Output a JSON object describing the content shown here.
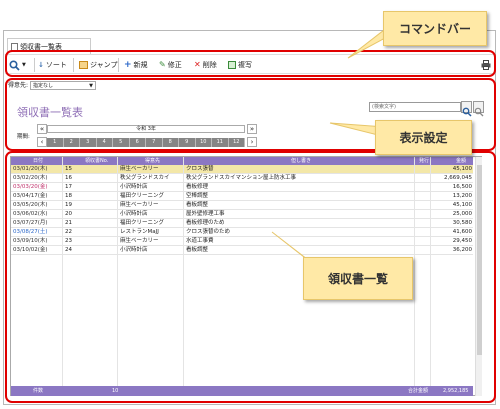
{
  "tab": {
    "title": "領収書一覧表"
  },
  "toolbar": {
    "sort": "ソート",
    "jump": "ジャンプ",
    "new": "新規",
    "edit": "修正",
    "delete": "削除",
    "copy": "複写"
  },
  "filter": {
    "label": "得意先:",
    "value": "指定なし"
  },
  "page": {
    "title": "領収書一覧表"
  },
  "search": {
    "placeholder": "(検索文字)"
  },
  "period": {
    "label": "期間:",
    "year": "令和 3年",
    "months": [
      "1",
      "2",
      "3",
      "4",
      "5",
      "6",
      "7",
      "8",
      "9",
      "10",
      "11",
      "12"
    ]
  },
  "table": {
    "headers": [
      "日付",
      "領収書No.",
      "得意先",
      "但し書き",
      "発行",
      "金額"
    ],
    "rows": [
      {
        "date": "03/01/20(木)",
        "no": "15",
        "customer": "麻生ベーカリー",
        "note": "クロス張替",
        "issued": "",
        "amount": "45,100"
      },
      {
        "date": "03/02/20(木)",
        "no": "16",
        "customer": "秩父グランドスカイ",
        "note": "秩父グランドスカイマンション屋上防水工事",
        "issued": "",
        "amount": "2,669,045"
      },
      {
        "date": "03/03/20(金)",
        "no": "17",
        "customer": "小沢時計店",
        "note": "看板修理",
        "issued": "",
        "amount": "16,500"
      },
      {
        "date": "03/04/17(金)",
        "no": "18",
        "customer": "福田クリーニング",
        "note": "空棒調整",
        "issued": "",
        "amount": "13,200"
      },
      {
        "date": "03/05/20(木)",
        "no": "19",
        "customer": "麻生ベーカリー",
        "note": "看板調整",
        "issued": "",
        "amount": "45,100"
      },
      {
        "date": "03/06/02(水)",
        "no": "20",
        "customer": "小沢時計店",
        "note": "屋外壁修理工事",
        "issued": "",
        "amount": "25,000"
      },
      {
        "date": "03/07/27(月)",
        "no": "21",
        "customer": "福田クリーニング",
        "note": "看板修理のため",
        "issued": "",
        "amount": "30,580"
      },
      {
        "date": "03/08/27(土)",
        "no": "22",
        "customer": "レストランMaJJ",
        "note": "クロス張替のため",
        "issued": "",
        "amount": "41,600"
      },
      {
        "date": "03/09/10(木)",
        "no": "23",
        "customer": "麻生ベーカリー",
        "note": "水道工事費",
        "issued": "",
        "amount": "29,450"
      },
      {
        "date": "03/10/02(金)",
        "no": "24",
        "customer": "小沢時計店",
        "note": "看板調整",
        "issued": "",
        "amount": "36,200"
      }
    ],
    "footer": {
      "count_label": "件数",
      "count": "10",
      "total_label": "合計金額",
      "total": "2,952,185"
    }
  },
  "callouts": {
    "command_bar": "コマンドバー",
    "display_settings": "表示設定",
    "receipt_list": "領収書一覧"
  },
  "colors": {
    "header": "#8b77c3",
    "title": "#8f6fb6",
    "red": "#e00000",
    "callout": "#ffe9a6"
  }
}
